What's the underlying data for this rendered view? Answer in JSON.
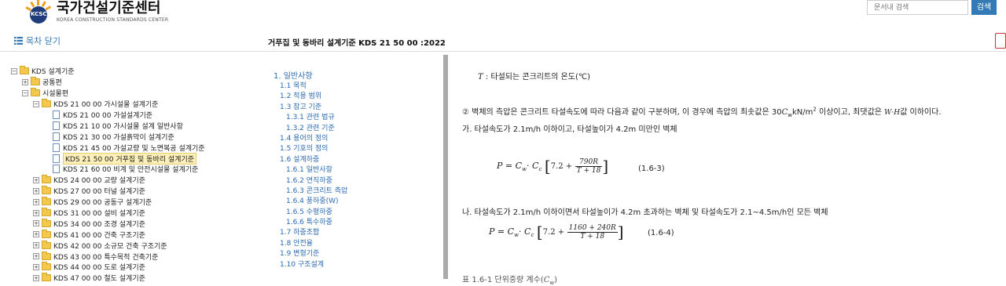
{
  "header": {
    "logo_title": "국가건설기준센터",
    "logo_subtitle": "KOREA CONSTRUCTION STANDARDS CENTER",
    "logo_emblem_text": "KCSC",
    "search_placeholder": "문서내 검색",
    "search_button": "검색"
  },
  "toolbar": {
    "toc_toggle_label": "목차 닫기",
    "doc_title": "거푸집 및 동바리 설계기준 KDS 21 50 00 :2022"
  },
  "tree": [
    {
      "sign": "⊟",
      "type": "folder",
      "label": "KDS 설계기준",
      "indent": 0
    },
    {
      "sign": "⊞",
      "type": "folder",
      "label": "공통편",
      "indent": 1
    },
    {
      "sign": "⊟",
      "type": "folder",
      "label": "시설물편",
      "indent": 1
    },
    {
      "sign": "⊟",
      "type": "folder",
      "label": "KDS 21 00 00 가시설물 설계기준",
      "indent": 2
    },
    {
      "sign": "",
      "type": "doc",
      "label": "KDS 21 00 00 가설설계기준",
      "indent": 3
    },
    {
      "sign": "",
      "type": "doc",
      "label": "KDS 21 10 00 가시설물 설계 일반사항",
      "indent": 3
    },
    {
      "sign": "",
      "type": "doc",
      "label": "KDS 21 30 00 가설흙막이 설계기준",
      "indent": 3
    },
    {
      "sign": "",
      "type": "doc",
      "label": "KDS 21 45 00 가설교량 및 노면복공 설계기준",
      "indent": 3
    },
    {
      "sign": "",
      "type": "doc",
      "label": "KDS 21 50 00 거푸집 및 동바리 설계기준",
      "indent": 3,
      "selected": true
    },
    {
      "sign": "",
      "type": "doc",
      "label": "KDS 21 60 00 비계 및 안전시설물 설계기준",
      "indent": 3
    },
    {
      "sign": "⊞",
      "type": "folder",
      "label": "KDS 24 00 00 교량 설계기준",
      "indent": 2
    },
    {
      "sign": "⊞",
      "type": "folder",
      "label": "KDS 27 00 00 터널 설계기준",
      "indent": 2
    },
    {
      "sign": "⊞",
      "type": "folder",
      "label": "KDS 29 00 00 공동구 설계기준",
      "indent": 2
    },
    {
      "sign": "⊞",
      "type": "folder",
      "label": "KDS 31 00 00 설비 설계기준",
      "indent": 2
    },
    {
      "sign": "⊞",
      "type": "folder",
      "label": "KDS 34 00 00 조경 설계기준",
      "indent": 2
    },
    {
      "sign": "⊞",
      "type": "folder",
      "label": "KDS 41 00 00 건축 구조기준",
      "indent": 2
    },
    {
      "sign": "⊞",
      "type": "folder",
      "label": "KDS 42 00 00 소규모 건축 구조기준",
      "indent": 2
    },
    {
      "sign": "⊞",
      "type": "folder",
      "label": "KDS 43 00 00 특수목적 건축기준",
      "indent": 2
    },
    {
      "sign": "⊞",
      "type": "folder",
      "label": "KDS 44 00 00 도로 설계기준",
      "indent": 2
    },
    {
      "sign": "⊞",
      "type": "folder",
      "label": "KDS 47 00 00 철도 설계기준",
      "indent": 2
    }
  ],
  "toc": {
    "heading": "1. 일반사항",
    "items": [
      {
        "label": "1.1 목적",
        "level": 1
      },
      {
        "label": "1.2 적용 범위",
        "level": 1
      },
      {
        "label": "1.3 참고 기준",
        "level": 1
      },
      {
        "label": "1.3.1 관련 법규",
        "level": 2
      },
      {
        "label": "1.3.2 관련 기준",
        "level": 2
      },
      {
        "label": "1.4 용어의 정의",
        "level": 1
      },
      {
        "label": "1.5 기호의 정의",
        "level": 1
      },
      {
        "label": "1.6 설계하중",
        "level": 1
      },
      {
        "label": "1.6.1 일반사항",
        "level": 2
      },
      {
        "label": "1.6.2 연직하중",
        "level": 2
      },
      {
        "label": "1.6.3 콘크리트 측압",
        "level": 2
      },
      {
        "label": "1.6.4 풍하중(W)",
        "level": 2
      },
      {
        "label": "1.6.5 수평하중",
        "level": 2
      },
      {
        "label": "1.6.6 특수하중",
        "level": 2
      },
      {
        "label": "1.7 하중조합",
        "level": 1
      },
      {
        "label": "1.8 안전율",
        "level": 1
      },
      {
        "label": "1.9 변형기준",
        "level": 1
      },
      {
        "label": "1.10 구조설계",
        "level": 1
      }
    ]
  },
  "content": {
    "line1_symbol": "T",
    "line1_text": " : 타설되는 콘크리트의 온도(℃)",
    "para2_a": "② 벽체의 측압은 콘크리트 타설속도에 따라 다음과 같이 구분하며, 이 경우에 측압의 최솟값은 30",
    "para2_sym": "C",
    "para2_sub": "w",
    "para2_b": "kN/m",
    "para2_sup": "2",
    "para2_c": " 이상이고, 최댓값은 ",
    "para2_max": "W·H",
    "para2_d": "값 이하이다.",
    "item_ga": "가. 타설속도가 2.1m/h 이하이고, 타설높이가 4.2m 미만인 벽체",
    "formula1_lhs": "P = C",
    "formula1_mid": "· C",
    "formula1_const": "7.2 +",
    "formula1_num": "790R",
    "formula1_den": "T + 18",
    "formula1_no": "(1.6-3)",
    "item_na": "나. 타설속도가 2.1m/h 이하이면서 타설높이가 4.2m 초과하는 벽체 및 타설속도가 2.1~4.5m/h인 모든 벽체",
    "formula2_lhs": "P = C",
    "formula2_mid": "· C",
    "formula2_const": "7.2 +",
    "formula2_num": "1160 + 240R",
    "formula2_den": "T + 18",
    "formula2_no": "(1.6-4)",
    "table_caption": "표 1.6-1 단위중량 계수(",
    "table_caption_sym": "C",
    "table_caption_sub": "w",
    "table_caption_end": ")"
  }
}
